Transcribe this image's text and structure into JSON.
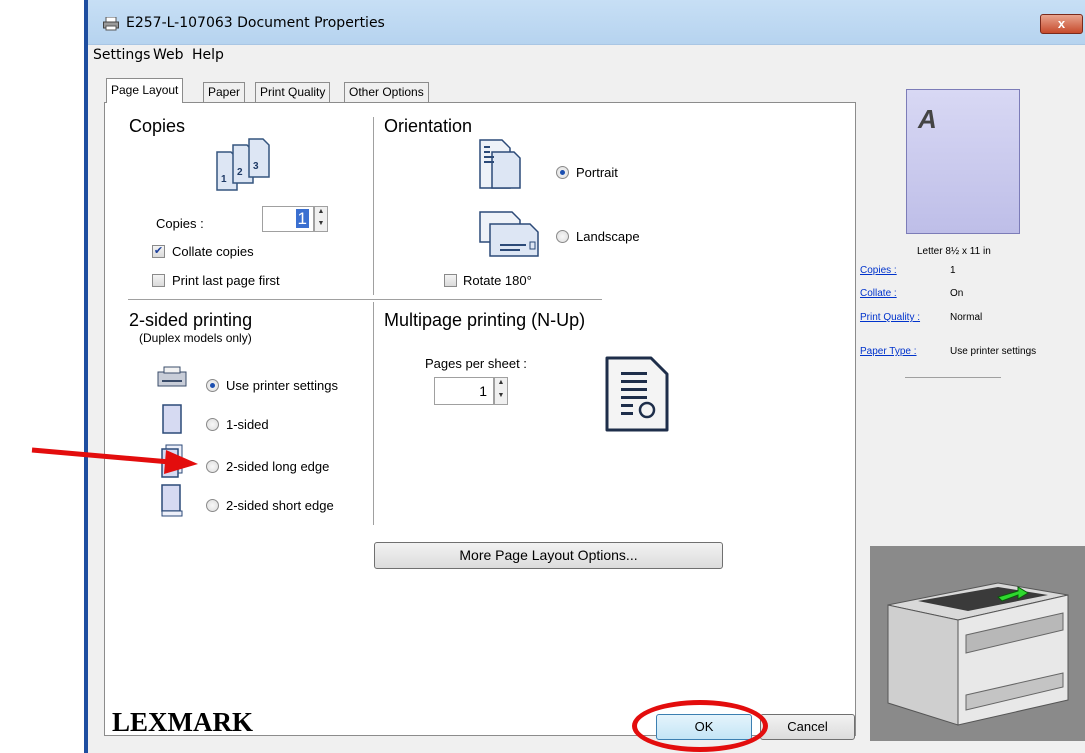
{
  "window": {
    "title": "E257-L-107063 Document Properties",
    "close_label": "x"
  },
  "menu": [
    "Settings",
    "Web",
    "Help"
  ],
  "tabs": [
    "Page Layout",
    "Paper",
    "Print Quality",
    "Other Options"
  ],
  "copies": {
    "heading": "Copies",
    "icon_digits": [
      "1",
      "2",
      "3"
    ],
    "label": "Copies :",
    "value": "1",
    "collate_label": "Collate copies",
    "collate_checked": true,
    "last_first_label": "Print last page first",
    "last_first_checked": false
  },
  "orientation": {
    "heading": "Orientation",
    "portrait_label": "Portrait",
    "landscape_label": "Landscape",
    "rotate_label": "Rotate 180°",
    "selected": "portrait"
  },
  "duplex": {
    "heading": "2-sided printing",
    "sub": "(Duplex models only)",
    "options": [
      "Use printer settings",
      "1-sided",
      "2-sided long edge",
      "2-sided short edge"
    ],
    "selected_index": 0
  },
  "nup": {
    "heading": "Multipage printing (N-Up)",
    "label": "Pages per sheet :",
    "value": "1"
  },
  "more_button": "More Page Layout Options...",
  "summary": {
    "page_letter": "A",
    "paper_size": "Letter 8½ x 11 in",
    "rows": [
      {
        "key": "Copies :",
        "value": "1"
      },
      {
        "key": "Collate :",
        "value": "On"
      },
      {
        "key": "Print Quality :",
        "value": "Normal"
      },
      {
        "key": "Paper Type :",
        "value": "Use printer settings"
      }
    ]
  },
  "brand": "LEXMARK",
  "buttons": {
    "ok": "OK",
    "cancel": "Cancel"
  },
  "annotation_color": "#e30d0d"
}
